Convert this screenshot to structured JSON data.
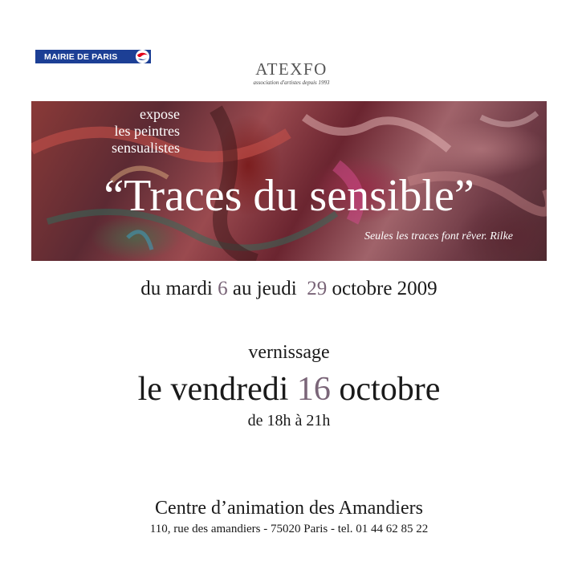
{
  "logo": {
    "mairie_text": "MAIRIE DE PARIS"
  },
  "header": {
    "org_name": "ATEXFO",
    "org_tagline": "association d'artistes depuis 1993"
  },
  "banner": {
    "expose_line1": "expose",
    "expose_line2": "les peintres",
    "expose_line3": "sensualistes",
    "title": "“Traces du sensible”",
    "quote": "Seules les traces font rêver. Rilke"
  },
  "dates": {
    "prefix": "du mardi ",
    "start_day": "6",
    "middle": " au jeudi  ",
    "end_day": "29",
    "suffix": " octobre 2009"
  },
  "vernissage": {
    "label": "vernissage",
    "prefix": "le vendredi ",
    "day": "16",
    "suffix": " octobre",
    "hours": "de 18h à 21h"
  },
  "venue": {
    "name": "Centre d’animation des Amandiers",
    "address": "110, rue des amandiers - 75020 Paris - tel. 01 44 62 85 22"
  },
  "colors": {
    "logo_blue": "#1c3f95",
    "logo_red": "#e2001a",
    "accent_numbers": "#7a6578"
  }
}
